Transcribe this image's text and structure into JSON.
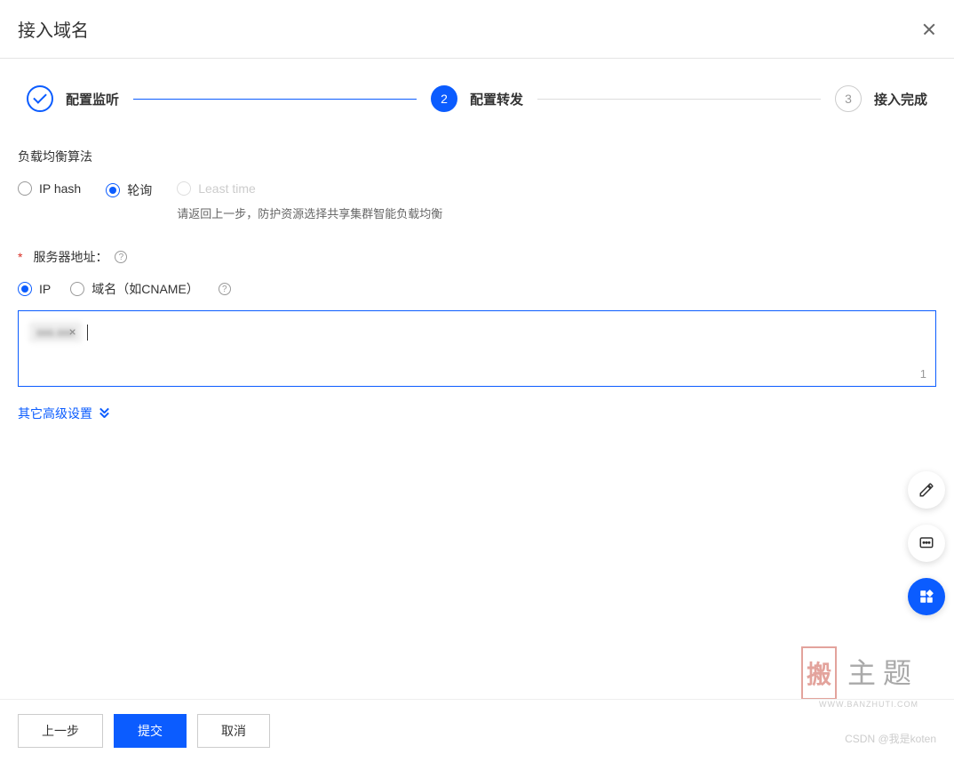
{
  "header": {
    "title": "接入域名"
  },
  "steps": [
    {
      "label": "配置监听",
      "state": "done"
    },
    {
      "label": "配置转发",
      "state": "active",
      "num": "2"
    },
    {
      "label": "接入完成",
      "state": "pending",
      "num": "3"
    }
  ],
  "loadbalance": {
    "label": "负载均衡算法",
    "options": [
      {
        "label": "IP hash",
        "selected": false,
        "disabled": false
      },
      {
        "label": "轮询",
        "selected": true,
        "disabled": false
      },
      {
        "label": "Least time",
        "selected": false,
        "disabled": true,
        "hint": "请返回上一步，防护资源选择共享集群智能负载均衡"
      }
    ]
  },
  "server_address": {
    "label": "服务器地址：",
    "options": [
      {
        "label": "IP",
        "selected": true
      },
      {
        "label": "域名（如CNAME）",
        "selected": false
      }
    ],
    "tag_value": "xxx.xxx",
    "counter": "1"
  },
  "advanced_link": "其它高级设置",
  "footer": {
    "prev": "上一步",
    "submit": "提交",
    "cancel": "取消"
  },
  "watermark": {
    "logo": "搬",
    "text": "主题",
    "sub": "WWW.BANZHUTI.COM"
  },
  "csdn": "CSDN @我是koten"
}
